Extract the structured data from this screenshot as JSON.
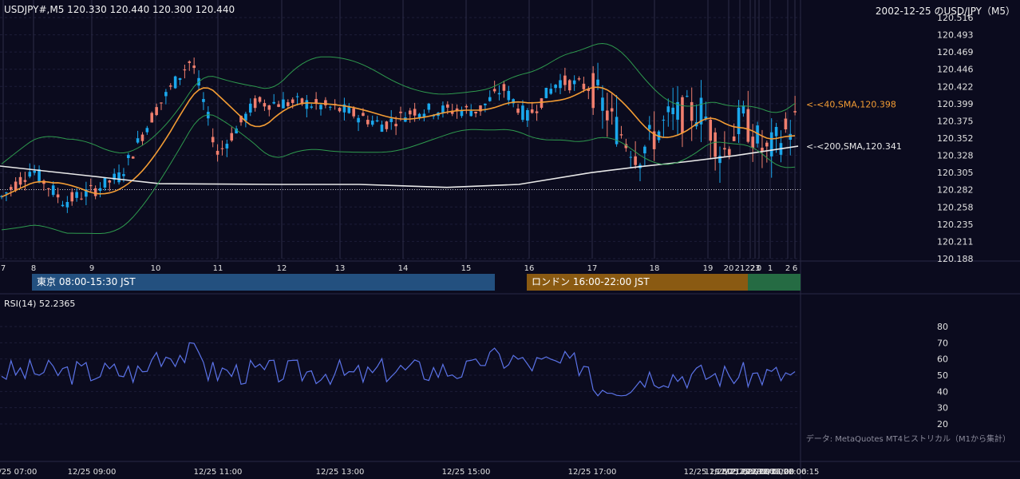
{
  "header": {
    "symbol_info": "USDJPY#,M5 120.330 120.440 120.300 120.440",
    "chart_title": "2002-12-25 のUSD/JPY（M5）"
  },
  "sessions": {
    "tokyo": "東京 08:00-15:30 JST",
    "london": "ロンドン 16:00-22:00 JST"
  },
  "rsi_label": "RSI(14) 52.2365",
  "credit": "データ: MetaQuotes MT4ヒストリカル（M1から集計）",
  "colors": {
    "background": "#0b0b1e",
    "bull": "#1aa7ec",
    "bear": "#f07f6e",
    "sma40": "#f39c34",
    "sma200": "#e8e8e8",
    "bollinger": "#2e9a4e",
    "rsi": "#5b73e8",
    "tokyo": "#23507f",
    "london": "#8a5a12",
    "overlap": "#256b43"
  },
  "chart_data": [
    {
      "type": "candlestick",
      "symbol": "USDJPY#",
      "timeframe": "M5",
      "ylim": [
        120.188,
        120.516
      ],
      "y_ticks": [
        "120.516",
        "120.493",
        "120.469",
        "120.446",
        "120.422",
        "120.399",
        "120.375",
        "120.352",
        "120.328",
        "120.305",
        "120.282",
        "120.258",
        "120.235",
        "120.211",
        "120.188"
      ],
      "x_ticks": [
        "7",
        "8",
        "9",
        "10",
        "11",
        "12",
        "13",
        "14",
        "15",
        "16",
        "17",
        "18",
        "19",
        "20",
        "21",
        "22",
        "23",
        "0",
        "1",
        "2",
        "6"
      ],
      "last_price": 120.282,
      "annotations": [
        {
          "text": "<-<40,SMA,120.398",
          "value": 120.398
        },
        {
          "text": "<-<200,SMA,120.341",
          "value": 120.341
        }
      ],
      "series": [
        {
          "name": "SMA 40",
          "value_end": 120.398
        },
        {
          "name": "SMA 200",
          "value_end": 120.341
        }
      ]
    },
    {
      "type": "line",
      "title": "RSI(14) 52.2365",
      "ylim": [
        20,
        80
      ],
      "y_ticks": [
        "80",
        "70",
        "60",
        "50",
        "40",
        "30",
        "20"
      ],
      "x_ticks": [
        "12/25 07:00",
        "12/25 09:00",
        "12/25 11:00",
        "12/25 13:00",
        "12/25 15:00",
        "12/25 17:00",
        "12/25 19:00",
        "12/25 21:00",
        "12/25 22:00",
        "12/25 23:00",
        "12/26 00:00",
        "12/26 01:00",
        "12/26 02:00",
        "12/26 06:15"
      ],
      "last_value": 52.2365
    }
  ]
}
